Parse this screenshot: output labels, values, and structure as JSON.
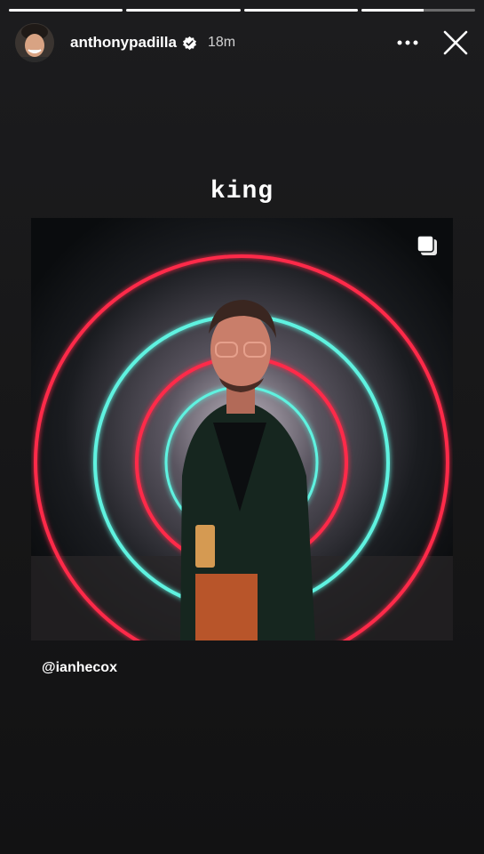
{
  "story": {
    "progress_segments": [
      1,
      1,
      1,
      0.55
    ],
    "username": "anthonypadilla",
    "verified": true,
    "timestamp": "18m",
    "caption": "king",
    "mention": "@ianhecox",
    "icons": {
      "more": "more-horizontal-icon",
      "close": "close-icon",
      "verified": "verified-badge-icon",
      "multi": "multiple-posts-icon"
    },
    "colors": {
      "background": "#1a1a1b",
      "neon_red": "#ff2a4a",
      "neon_cyan": "#5ff2e0"
    }
  }
}
